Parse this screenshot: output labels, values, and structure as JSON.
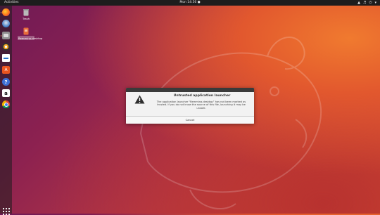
{
  "topbar": {
    "activities": "Activities",
    "clock": "Mon 14:56 ●",
    "tray_icons": [
      "network-icon",
      "volume-icon",
      "power-icon",
      "chevron-down-icon"
    ]
  },
  "dock": {
    "items": [
      {
        "name": "firefox-icon"
      },
      {
        "name": "thunderbird-icon"
      },
      {
        "name": "files-icon"
      },
      {
        "name": "rhythmbox-icon"
      },
      {
        "name": "libreoffice-writer-icon"
      },
      {
        "name": "software-center-icon"
      },
      {
        "name": "help-icon"
      },
      {
        "name": "amazon-icon"
      },
      {
        "name": "chrome-icon"
      }
    ],
    "show_apps": "apps-grid-icon"
  },
  "desktop": {
    "icons": [
      {
        "label": "Trash",
        "icon": "trash-icon"
      },
      {
        "label": "Remmina.desktop",
        "icon": "launcher-file-icon"
      }
    ]
  },
  "dialog": {
    "title": "Untrusted application launcher",
    "message": "The application launcher “Remmina.desktop” has not been marked as trusted. If you do not know the source of this file, launching it may be unsafe.",
    "cancel_label": "Cancel",
    "icon": "warning-icon"
  },
  "colors": {
    "topbar": "#1d1d1d",
    "dialog_bg": "#f2f2f2",
    "titlebar": "#3a3a3a",
    "accent": "#e95420"
  }
}
